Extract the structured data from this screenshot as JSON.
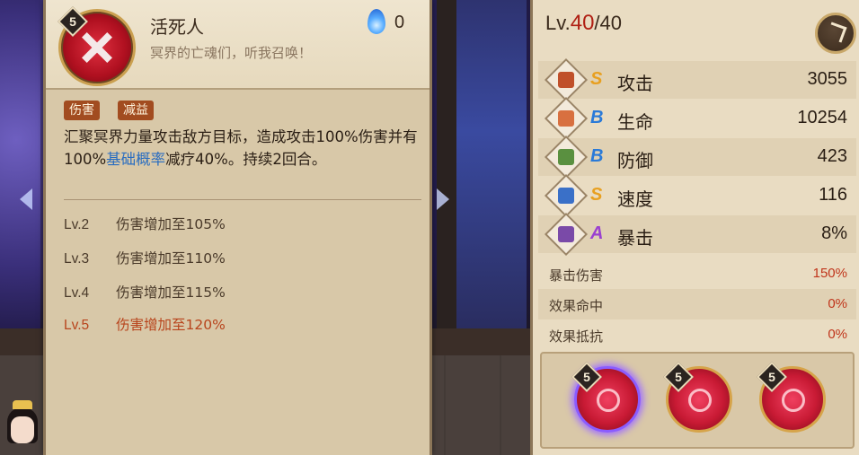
{
  "skill": {
    "level": "5",
    "name": "活死人",
    "subtitle": "冥界的亡魂们，听我召唤！",
    "cost": "0",
    "tags": [
      "伤害",
      "减益"
    ],
    "desc_part1": "汇聚冥界力量攻击敌方目标，造成攻击100%伤害并有100%",
    "desc_highlight": "基础概率",
    "desc_part2": "减疗40%。持续2回合。",
    "upgrades": [
      {
        "lv": "Lv.2",
        "text": "伤害增加至105%"
      },
      {
        "lv": "Lv.3",
        "text": "伤害增加至110%"
      },
      {
        "lv": "Lv.4",
        "text": "伤害增加至115%"
      },
      {
        "lv": "Lv.5",
        "text": "伤害增加至120%"
      }
    ]
  },
  "stats": {
    "lv_prefix": "Lv.",
    "lv_current": "40",
    "lv_max": "/40",
    "main": [
      {
        "icon": "attack-icon",
        "grade": "S",
        "grade_color": "#e8a020",
        "label": "攻击",
        "value": "3055"
      },
      {
        "icon": "hp-icon",
        "grade": "B",
        "grade_color": "#2a7ad8",
        "label": "生命",
        "value": "10254"
      },
      {
        "icon": "defense-icon",
        "grade": "B",
        "grade_color": "#2a7ad8",
        "label": "防御",
        "value": "423"
      },
      {
        "icon": "speed-icon",
        "grade": "S",
        "grade_color": "#e8a020",
        "label": "速度",
        "value": "116"
      },
      {
        "icon": "crit-icon",
        "grade": "A",
        "grade_color": "#9a40d0",
        "label": "暴击",
        "value": "8%"
      }
    ],
    "sub": [
      {
        "label": "暴击伤害",
        "value": "150%"
      },
      {
        "label": "效果命中",
        "value": "0%"
      },
      {
        "label": "效果抵抗",
        "value": "0%"
      }
    ],
    "tray_levels": [
      "5",
      "5",
      "5"
    ]
  },
  "colors": {
    "accent_red": "#b02014",
    "highlight_blue": "#2a6dc0",
    "tag_bg": "#a24c20"
  }
}
